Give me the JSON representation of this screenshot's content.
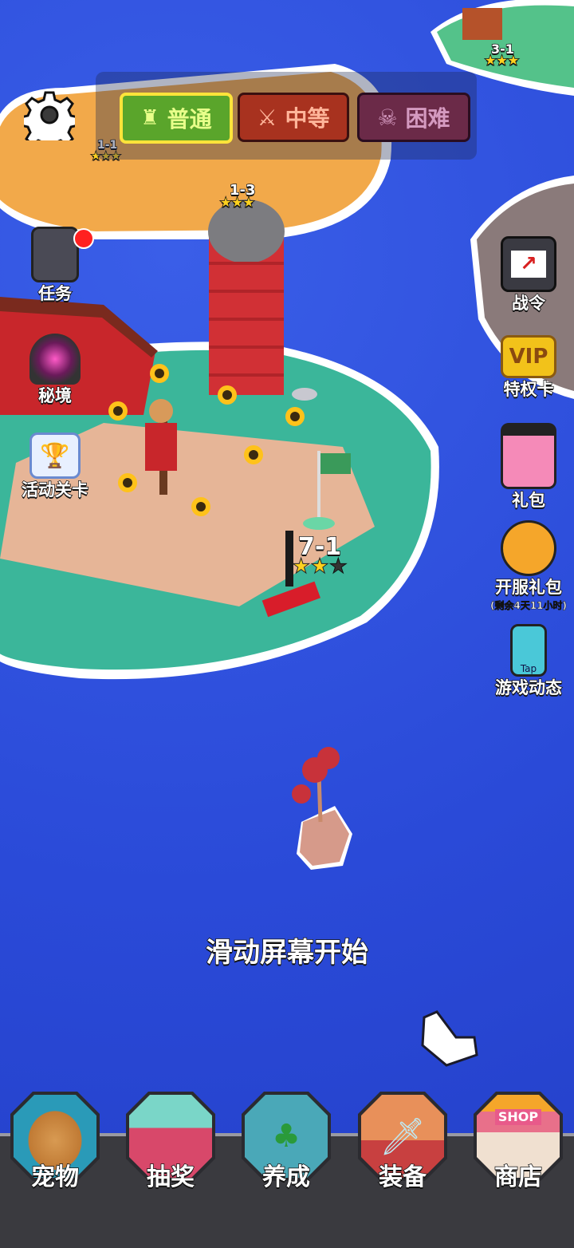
{
  "difficulty": {
    "normal": "普通",
    "medium": "中等",
    "hard": "困难"
  },
  "map": {
    "levels": [
      {
        "id": "1-1"
      },
      {
        "id": "1-3"
      },
      {
        "id": "3-1"
      }
    ],
    "current_level": {
      "id": "7-1",
      "stars": 2,
      "max_stars": 3
    }
  },
  "left_menu": {
    "tasks": "任务",
    "secret_realm": "秘境",
    "event_stage": "活动关卡"
  },
  "right_menu": {
    "battle_pass": "战令",
    "vip_card": "特权卡",
    "vip_badge": "VIP",
    "gift_pack": "礼包",
    "launch_pack": "开服礼包",
    "launch_pack_timer": "(剩余4天11小时)",
    "game_news": "游戏动态",
    "tap_badge": "Tap"
  },
  "hint": "滑动屏幕开始",
  "bottom_nav": {
    "pet": "宠物",
    "lottery": "抽奖",
    "cultivate": "养成",
    "equipment": "装备",
    "shop": "商店",
    "shop_sign": "SHOP"
  },
  "colors": {
    "ocean": "#2a4ad8",
    "normal_btn": "#5aa52b",
    "medium_btn": "#a8321f",
    "hard_btn": "#6b2a48",
    "island_grass": "#3bb69a",
    "sand": "#f2a94a",
    "star": "#ffd21f"
  }
}
